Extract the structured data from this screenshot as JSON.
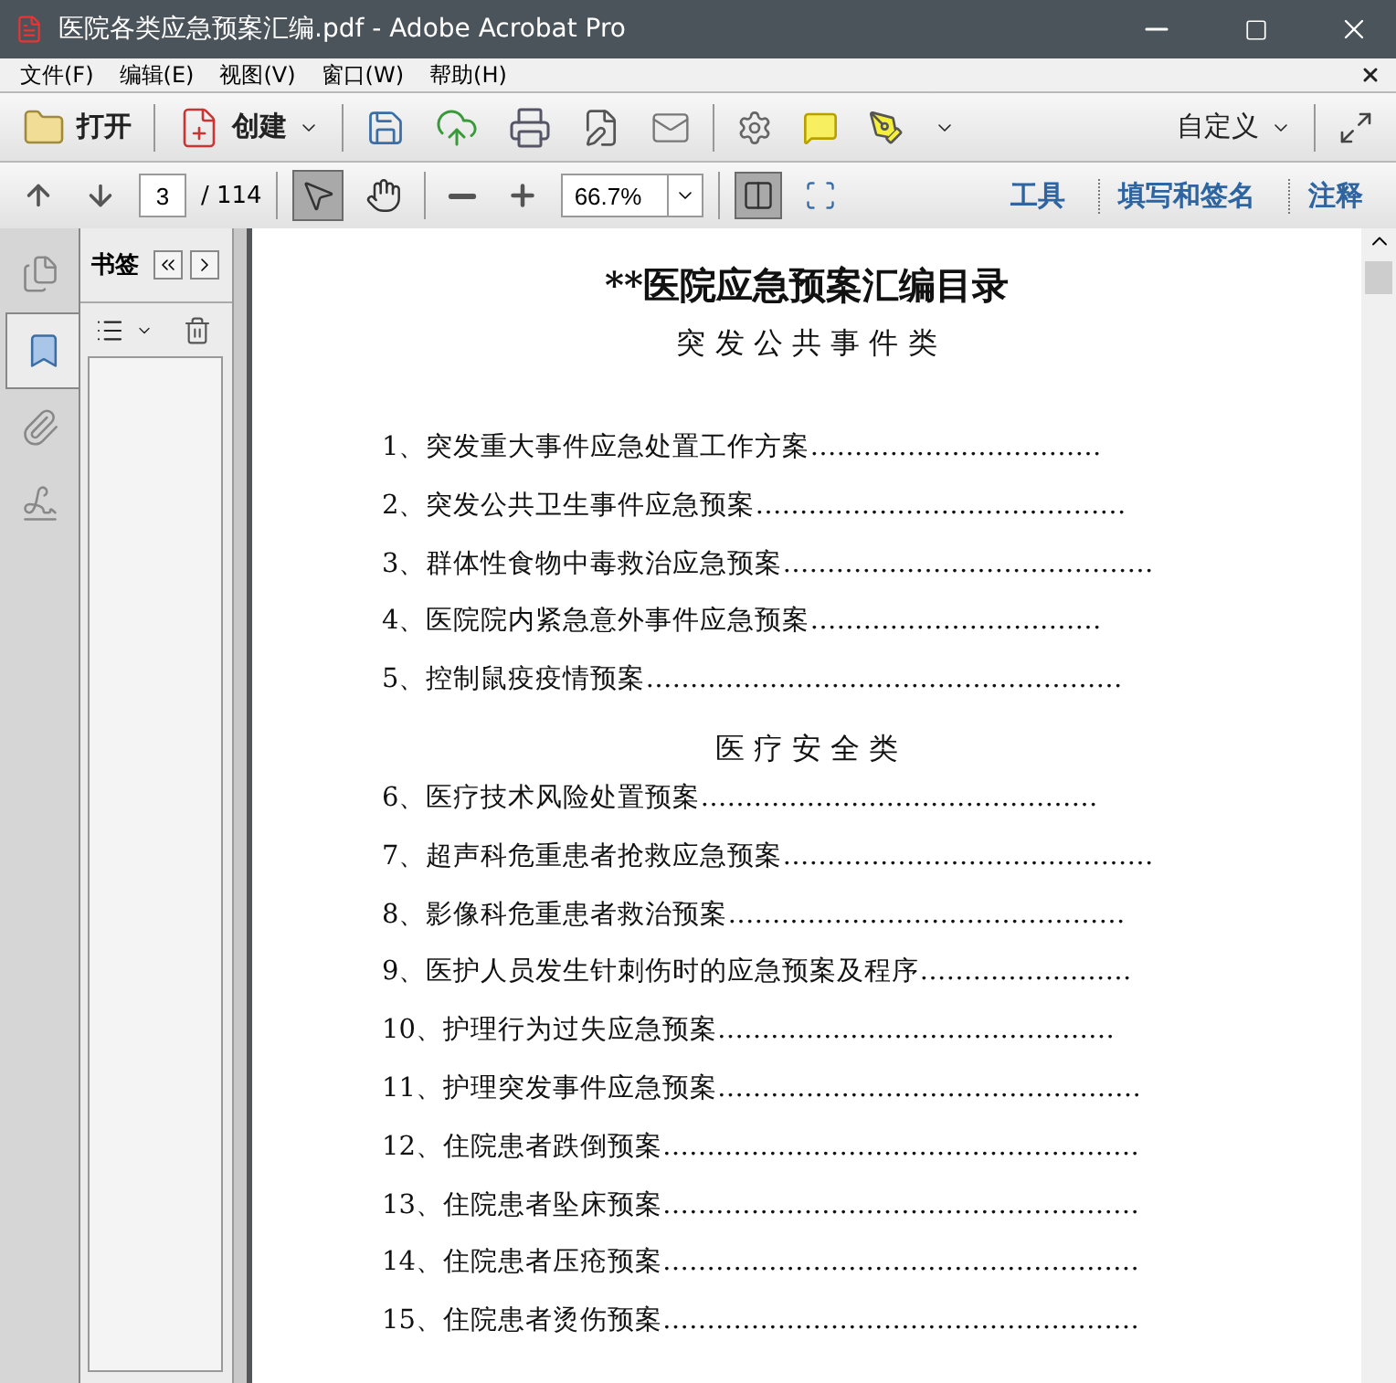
{
  "window": {
    "title": "医院各类应急预案汇编.pdf - Adobe Acrobat Pro"
  },
  "menu": [
    "文件(F)",
    "编辑(E)",
    "视图(V)",
    "窗口(W)",
    "帮助(H)"
  ],
  "toolbar": {
    "open": "打开",
    "create": "创建",
    "customize": "自定义"
  },
  "navigation": {
    "page": "3",
    "total": "/ 114",
    "zoom": "66.7%",
    "tools": [
      {
        "kind": "select",
        "selected": true
      },
      {
        "kind": "hand",
        "selected": false
      }
    ]
  },
  "task_tabs": [
    "工具",
    "填写和签名",
    "注释"
  ],
  "side_tabs": [
    {
      "kind": "pages",
      "selected": false
    },
    {
      "kind": "bookmarks",
      "selected": true
    },
    {
      "kind": "attachments",
      "selected": false
    },
    {
      "kind": "signatures",
      "selected": false
    }
  ],
  "panel": {
    "title": "书签"
  },
  "document": {
    "title": "**医院应急预案汇编目录",
    "sections": [
      {
        "heading": "突 发 公 共 事 件 类",
        "entries": [
          {
            "text": "1、突发重大事件应急处置工作方案",
            "leader": "……………………………"
          },
          {
            "text": "2、突发公共卫生事件应急预案",
            "leader": "……………………………………"
          },
          {
            "text": "3、群体性食物中毒救治应急预案",
            "leader": "……………………………………"
          },
          {
            "text": "4、医院院内紧急意外事件应急预案",
            "leader": "……………………………"
          },
          {
            "text": "5、控制鼠疫疫情预案",
            "leader": "………………………………………………"
          }
        ]
      },
      {
        "heading": "医 疗 安 全 类",
        "entries": [
          {
            "text": "6、医疗技术风险处置预案",
            "leader": "………………………………………"
          },
          {
            "text": "7、超声科危重患者抢救应急预案",
            "leader": "……………………………………"
          },
          {
            "text": "8、影像科危重患者救治预案",
            "leader": "………………………………………"
          },
          {
            "text": "9、医护人员发生针刺伤时的应急预案及程序",
            "leader": "……………………"
          },
          {
            "text": "10、护理行为过失应急预案",
            "leader": "………………………………………"
          },
          {
            "text": "11、护理突发事件应急预案",
            "leader": "…………………………………………"
          },
          {
            "text": "12、住院患者跌倒预案",
            "leader": "………………………………………………"
          },
          {
            "text": "13、住院患者坠床预案",
            "leader": "………………………………………………"
          },
          {
            "text": "14、住院患者压疮预案",
            "leader": "………………………………………………"
          },
          {
            "text": "15、住院患者烫伤预案",
            "leader": "………………………………………………"
          }
        ]
      }
    ]
  }
}
